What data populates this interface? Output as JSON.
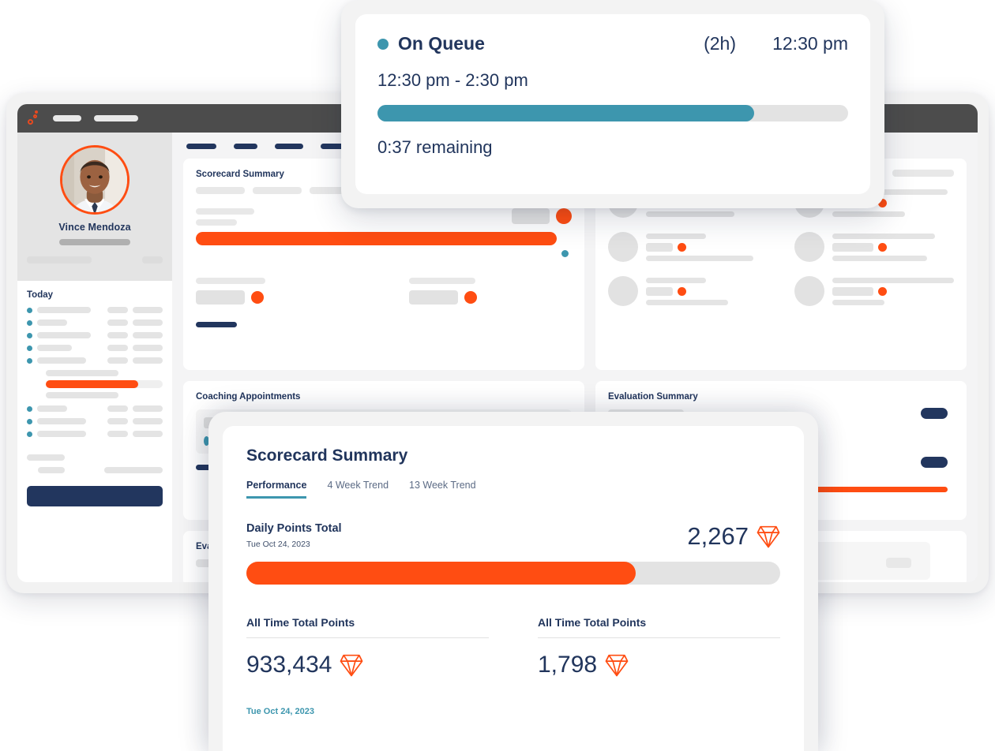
{
  "app": {
    "logo_name": "brand-logo",
    "background_color": "#ffffff",
    "accent_orange": "#ff4d12",
    "accent_teal": "#3d96ae",
    "navy": "#21355c"
  },
  "dashboard": {
    "sidebar": {
      "profile": {
        "name": "Vince Mendoza",
        "avatar_name": "user-avatar"
      },
      "today_label": "Today",
      "today_rows": [
        {
          "label_w": 68,
          "a_w": 26,
          "b_w": 38
        },
        {
          "label_w": 38,
          "a_w": 26,
          "b_w": 38
        },
        {
          "label_w": 68,
          "a_w": 26,
          "b_w": 38
        },
        {
          "label_w": 44,
          "a_w": 26,
          "b_w": 38
        },
        {
          "label_w": 62,
          "a_w": 26,
          "b_w": 38
        }
      ],
      "progress_percent": 79,
      "today_rows_2": [
        {
          "label_w": 38,
          "a_w": 26,
          "b_w": 38
        },
        {
          "label_w": 62,
          "a_w": 26,
          "b_w": 38
        },
        {
          "label_w": 62,
          "a_w": 26,
          "b_w": 38
        }
      ]
    },
    "panels": {
      "scorecard_summary_title": "Scorecard Summary",
      "coaching_appointments_title": "Coaching Appointments",
      "evaluation_summary_title": "Evaluation Summary"
    }
  },
  "on_queue_card": {
    "status_label": "On Queue",
    "duration_label": "(2h)",
    "start_time": "12:30 pm",
    "time_range": "12:30 pm - 2:30 pm",
    "progress_percent": 80,
    "remaining_label": "0:37 remaining",
    "status_dot_color": "#3d96ae"
  },
  "scorecard_card": {
    "title": "Scorecard Summary",
    "tabs": [
      {
        "label": "Performance",
        "active": true
      },
      {
        "label": "4 Week Trend",
        "active": false
      },
      {
        "label": "13 Week Trend",
        "active": false
      }
    ],
    "daily": {
      "label": "Daily Points Total",
      "date": "Tue Oct 24, 2023",
      "value": "2,267",
      "progress_percent": 73,
      "gem_icon": "diamond-icon"
    },
    "stats": [
      {
        "label": "All Time Total Points",
        "value": "933,434",
        "gem_icon": "diamond-icon"
      },
      {
        "label": "All Time Total Points",
        "value": "1,798",
        "gem_icon": "diamond-icon"
      }
    ],
    "footer_date": "Tue Oct 24, 2023"
  }
}
